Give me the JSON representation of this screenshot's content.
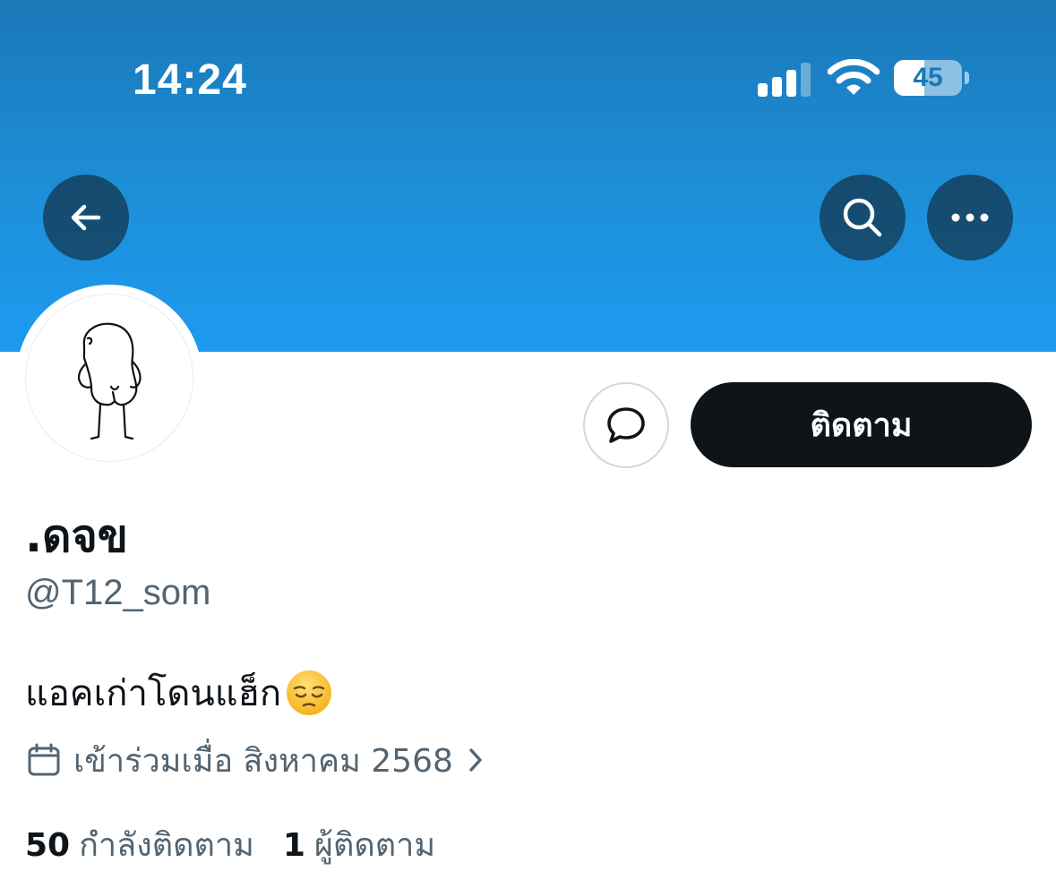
{
  "status_bar": {
    "time": "14:24",
    "battery_level": "45",
    "battery_fraction": 0.45
  },
  "header": {
    "back_icon": "arrow-left-icon",
    "search_icon": "search-icon",
    "more_icon": "more-horizontal-icon"
  },
  "colors": {
    "banner_top": "#1a78b8",
    "banner_bottom": "#1d9bf0",
    "button_dark": "#0f1419",
    "secondary_text": "#536471"
  },
  "profile": {
    "follow_label": "ติดตาม",
    "message_icon": "message-bubble-icon",
    "display_name": ".ดจข",
    "handle": "@T12_som",
    "bio": "แอคเก่าโดนแฮ็ก",
    "bio_emoji": "pensive-face-emoji",
    "joined_text": "เข้าร่วมเมื่อ สิงหาคม 2568",
    "following_count": "50",
    "following_label": "กำลังติดตาม",
    "followers_count": "1",
    "followers_label": "ผู้ติดตาม"
  }
}
